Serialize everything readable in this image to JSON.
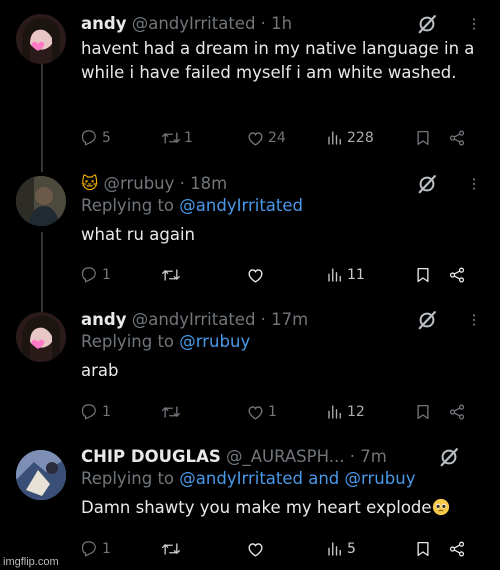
{
  "tweets": [
    {
      "name": "andy",
      "handle": "@andyIrritated",
      "time": "1h",
      "replying_prefix": "",
      "replying_to": "",
      "text": "havent had a dream in my native language in a while i have failed myself i am white washed.",
      "replies": "5",
      "retweets": "1",
      "likes": "24",
      "views": "228"
    },
    {
      "name": "🐱",
      "handle": "@rrubuy",
      "time": "18m",
      "replying_prefix": "Replying to ",
      "replying_to": "@andyIrritated",
      "text": "what ru again",
      "replies": "1",
      "retweets": "",
      "likes": "",
      "views": "11"
    },
    {
      "name": "andy",
      "handle": "@andyIrritated",
      "time": "17m",
      "replying_prefix": "Replying to ",
      "replying_to": "@rrubuy",
      "text": "arab",
      "replies": "1",
      "retweets": "",
      "likes": "1",
      "views": "12"
    },
    {
      "name": "CHIP DOUGLAS",
      "handle": "@_AURASPH...",
      "time": "7m",
      "replying_prefix": "Replying to ",
      "replying_to": "@andyIrritated and @rrubuy",
      "text": "Damn shawty you make my heart explode",
      "replies": "1",
      "retweets": "",
      "likes": "",
      "views": "5"
    }
  ],
  "separator": "·",
  "watermark": "imgflip.com",
  "colors": {
    "background": "#000000",
    "text": "#e7e9ea",
    "muted": "#71767b",
    "link": "#4a99e9"
  },
  "icons": [
    "reply-icon",
    "retweet-icon",
    "like-icon",
    "views-icon",
    "bookmark-icon",
    "share-icon",
    "grok-icon",
    "more-icon",
    "pleading-face-emoji"
  ]
}
